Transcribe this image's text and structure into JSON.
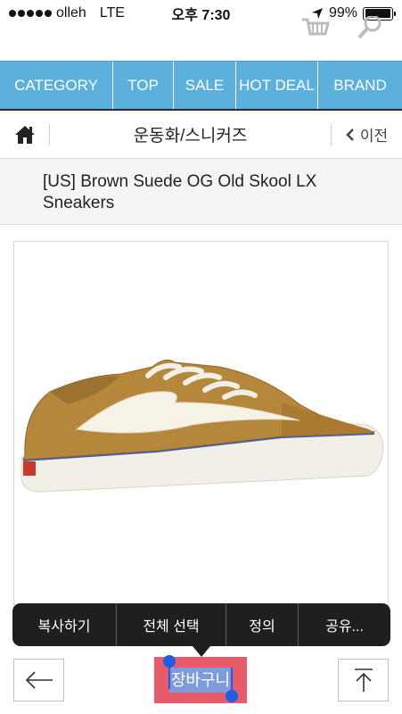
{
  "status_bar": {
    "carrier": "olleh",
    "network": "LTE",
    "time": "오후 7:30",
    "battery": "99%",
    "battery_level": 0.99
  },
  "nav": {
    "items": [
      "CATEGORY",
      "TOP",
      "SALE",
      "HOT DEAL",
      "BRAND"
    ]
  },
  "breadcrumb": {
    "title": "운동화/스니커즈",
    "prev_label": "이전"
  },
  "product": {
    "title": "[US] Brown Suede OG Old Skool LX Sneakers"
  },
  "context_menu": {
    "items": [
      "복사하기",
      "전체 선택",
      "정의",
      "공유..."
    ]
  },
  "bottom_bar": {
    "cart_label": "장바구니"
  },
  "colors": {
    "nav_bg": "#5bb1dc",
    "cart_bg": "#e85b6b",
    "selection": "#7e9bd9",
    "handle": "#1a5fe6"
  }
}
